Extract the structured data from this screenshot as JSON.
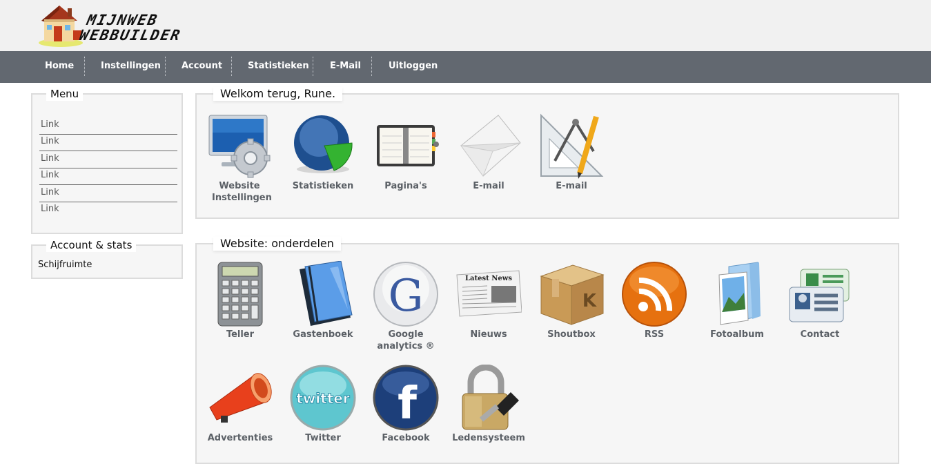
{
  "header": {
    "logo_line1": "MIJNWEB",
    "logo_line2": "WEBBUILDER"
  },
  "nav": [
    "Home",
    "Instellingen",
    "Account",
    "Statistieken",
    "E-Mail",
    "Uitloggen"
  ],
  "sidebar": {
    "menu_title": "Menu",
    "links": [
      "Link",
      "Link",
      "Link",
      "Link",
      "Link",
      "Link"
    ],
    "stats_title": "Account & stats",
    "stats_label": "Schijfruimte"
  },
  "welcome": {
    "title": "Welkom terug, Rune.",
    "tiles": [
      {
        "label": "Website Instellingen",
        "icon": "monitor-gear-icon"
      },
      {
        "label": "Statistieken",
        "icon": "pie-chart-icon"
      },
      {
        "label": "Pagina's",
        "icon": "notebook-icon"
      },
      {
        "label": "E-mail",
        "icon": "envelope-icon"
      },
      {
        "label": "E-mail",
        "icon": "drafting-tools-icon"
      }
    ]
  },
  "parts": {
    "title": "Website: onderdelen",
    "tiles": [
      {
        "label": "Teller",
        "icon": "calculator-icon"
      },
      {
        "label": "Gastenboek",
        "icon": "book-icon"
      },
      {
        "label": "Google analytics ®",
        "icon": "google-icon"
      },
      {
        "label": "Nieuws",
        "icon": "newspaper-icon"
      },
      {
        "label": "Shoutbox",
        "icon": "box-icon"
      },
      {
        "label": "RSS",
        "icon": "rss-icon"
      },
      {
        "label": "Fotoalbum",
        "icon": "photo-folder-icon"
      },
      {
        "label": "Contact",
        "icon": "contact-card-icon"
      },
      {
        "label": "Advertenties",
        "icon": "megaphone-icon"
      },
      {
        "label": "Twitter",
        "icon": "twitter-icon"
      },
      {
        "label": "Facebook",
        "icon": "facebook-icon"
      },
      {
        "label": "Ledensysteem",
        "icon": "padlock-key-icon"
      }
    ],
    "newspaper_headline": "Latest News",
    "twitter_word": "twitter",
    "facebook_letter": "f",
    "google_letter": "G"
  },
  "colors": {
    "navbar": "#626870",
    "header_bg": "#f1f1f1",
    "box_border": "#dcdcdc",
    "tile_label": "#5b6066"
  }
}
